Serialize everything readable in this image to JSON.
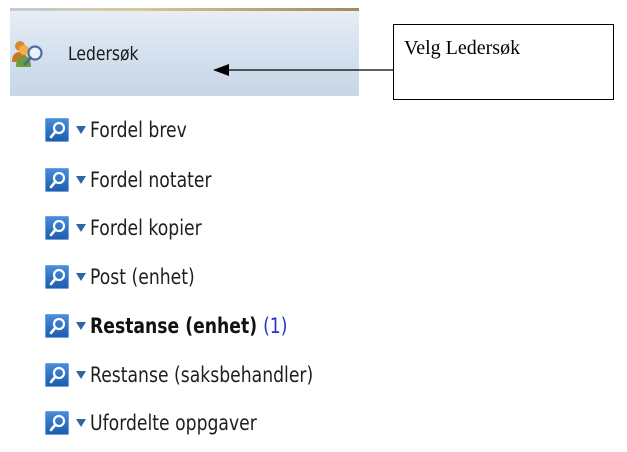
{
  "header": {
    "label": "Ledersøk",
    "icon": "people-search-icon"
  },
  "callout": {
    "text": "Velg Ledersøk"
  },
  "menu": {
    "items": [
      {
        "label": "Fordel brev",
        "bold": false,
        "count": ""
      },
      {
        "label": "Fordel notater",
        "bold": false,
        "count": ""
      },
      {
        "label": "Fordel kopier",
        "bold": false,
        "count": ""
      },
      {
        "label": "Post (enhet)",
        "bold": false,
        "count": ""
      },
      {
        "label": "Restanse (enhet)",
        "bold": true,
        "count": "(1)"
      },
      {
        "label": "Restanse (saksbehandler)",
        "bold": false,
        "count": ""
      },
      {
        "label": "Ufordelte oppgaver",
        "bold": false,
        "count": ""
      }
    ]
  },
  "colors": {
    "count": "#2233cc",
    "icon_blue": "#2c6fc2"
  }
}
